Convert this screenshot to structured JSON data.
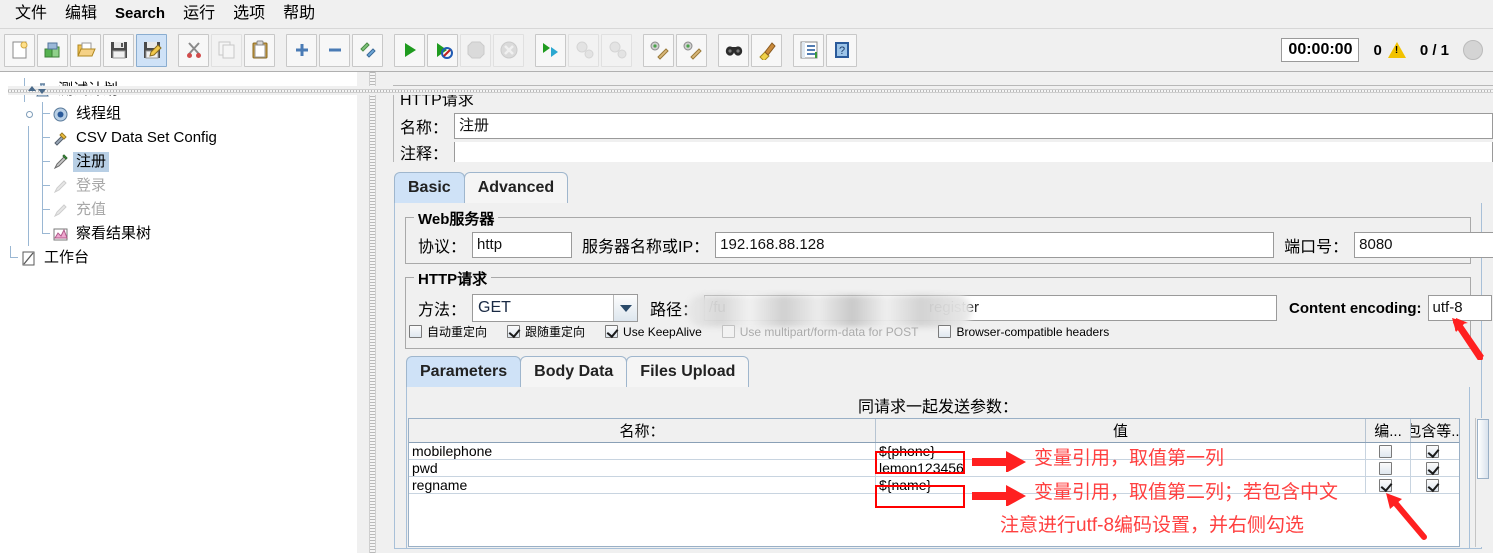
{
  "menu": {
    "items": [
      {
        "label": "文件",
        "latin": false
      },
      {
        "label": "编辑",
        "latin": false
      },
      {
        "label": "Search",
        "latin": true
      },
      {
        "label": "运行",
        "latin": false
      },
      {
        "label": "选项",
        "latin": false
      },
      {
        "label": "帮助",
        "latin": false
      }
    ]
  },
  "toolbar": {
    "buttons": [
      {
        "name": "new-icon",
        "state": "normal"
      },
      {
        "name": "templates-icon",
        "state": "normal"
      },
      {
        "name": "open-icon",
        "state": "normal"
      },
      {
        "name": "save-icon",
        "state": "normal"
      },
      {
        "name": "save-as-icon",
        "state": "selected"
      },
      {
        "name": "cut-icon",
        "state": "normal"
      },
      {
        "name": "copy-icon",
        "state": "disabled"
      },
      {
        "name": "paste-icon",
        "state": "normal"
      },
      {
        "name": "expand-all-icon",
        "state": "normal"
      },
      {
        "name": "collapse-all-icon",
        "state": "normal"
      },
      {
        "name": "toggle-icon",
        "state": "normal"
      },
      {
        "name": "start-icon",
        "state": "normal"
      },
      {
        "name": "start-no-pause-icon",
        "state": "normal"
      },
      {
        "name": "stop-icon",
        "state": "disabled"
      },
      {
        "name": "shutdown-icon",
        "state": "disabled"
      },
      {
        "name": "start-remote-icon",
        "state": "normal"
      },
      {
        "name": "stop-remote-icon",
        "state": "disabled"
      },
      {
        "name": "shutdown-remote-icon",
        "state": "disabled"
      },
      {
        "name": "clear-icon",
        "state": "normal"
      },
      {
        "name": "clear-all-icon",
        "state": "normal"
      },
      {
        "name": "search-icon",
        "state": "normal"
      },
      {
        "name": "search-reset-icon",
        "state": "normal"
      },
      {
        "name": "function-helper-icon",
        "state": "normal"
      },
      {
        "name": "help-icon",
        "state": "normal"
      }
    ],
    "status": {
      "elapsed_time": "00:00:00",
      "warning_count": "0",
      "thread_counts": "0 / 1"
    }
  },
  "tree": {
    "nodes": [
      {
        "label": "测试计划",
        "icon": "test-plan-icon",
        "depth": 0,
        "selected": false,
        "disabled": false,
        "expandable": true
      },
      {
        "label": "线程组",
        "icon": "thread-group-icon",
        "depth": 1,
        "selected": false,
        "disabled": false,
        "expandable": true
      },
      {
        "label": "CSV Data Set Config",
        "icon": "config-element-icon",
        "depth": 2,
        "selected": false,
        "disabled": false,
        "expandable": false
      },
      {
        "label": "注册",
        "icon": "http-sampler-icon",
        "depth": 2,
        "selected": true,
        "disabled": false,
        "expandable": false
      },
      {
        "label": "登录",
        "icon": "http-sampler-icon",
        "depth": 2,
        "selected": false,
        "disabled": true,
        "expandable": false
      },
      {
        "label": "充值",
        "icon": "http-sampler-icon",
        "depth": 2,
        "selected": false,
        "disabled": true,
        "expandable": false
      },
      {
        "label": "察看结果树",
        "icon": "view-results-tree-icon",
        "depth": 2,
        "selected": false,
        "disabled": false,
        "expandable": false,
        "last": true
      },
      {
        "label": "工作台",
        "icon": "workbench-icon",
        "depth": 0,
        "selected": false,
        "disabled": false,
        "expandable": false,
        "last": true
      }
    ]
  },
  "panel": {
    "title": "HTTP请求",
    "name_label": "名称：",
    "name_value": "注册",
    "comment_label": "注释：",
    "comment_value": ""
  },
  "tabs": {
    "main": [
      {
        "label": "Basic",
        "active": true
      },
      {
        "label": "Advanced",
        "active": false
      }
    ],
    "sub": [
      {
        "label": "Parameters",
        "active": true
      },
      {
        "label": "Body Data",
        "active": false
      },
      {
        "label": "Files Upload",
        "active": false
      }
    ]
  },
  "web_server": {
    "group_title": "Web服务器",
    "protocol_label": "协议：",
    "protocol_value": "http",
    "server_label": "服务器名称或IP：",
    "server_value": "192.168.88.128",
    "port_label": "端口号：",
    "port_value": "8080"
  },
  "http_request": {
    "group_title": "HTTP请求",
    "method_label": "方法：",
    "method_value": "GET",
    "path_label": "路径：",
    "path_value_prefix": "/fu",
    "path_value_suffix": "register",
    "content_encoding_label": "Content encoding:",
    "content_encoding_value": "utf-8",
    "checkboxes": [
      {
        "label": "自动重定向",
        "checked": false,
        "disabled": false
      },
      {
        "label": "跟随重定向",
        "checked": true,
        "disabled": false
      },
      {
        "label": "Use KeepAlive",
        "checked": true,
        "disabled": false
      },
      {
        "label": "Use multipart/form-data for POST",
        "checked": false,
        "disabled": true
      },
      {
        "label": "Browser-compatible headers",
        "checked": false,
        "disabled": false
      }
    ]
  },
  "parameters_table": {
    "caption": "同请求一起发送参数：",
    "columns": [
      "名称：",
      "值",
      "编...",
      "包含等..."
    ],
    "rows": [
      {
        "name": "mobilephone",
        "value": "${phone}",
        "encode": false,
        "include_equals": true
      },
      {
        "name": "pwd",
        "value": "lemon123456",
        "encode": false,
        "include_equals": true
      },
      {
        "name": "regname",
        "value": "${name}",
        "encode": true,
        "include_equals": true
      }
    ]
  },
  "annotations": {
    "encoding_arrow": "arrow-pointing-to-content-encoding",
    "note_phone": "变量引用，取值第一列",
    "note_name_line1": "变量引用，取值第二列；若包含中文",
    "note_name_line2": "注意进行utf-8编码设置，并右侧勾选",
    "highlight_color": "#ff0000",
    "text_color": "#ff4040"
  }
}
